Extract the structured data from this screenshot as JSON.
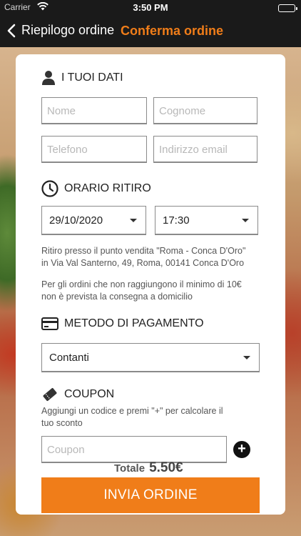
{
  "status_bar": {
    "carrier": "Carrier",
    "time": "3:50 PM"
  },
  "nav": {
    "back_label": "Riepilogo ordine",
    "title": "Conferma ordine",
    "accent_color": "#f07d19"
  },
  "personal": {
    "title": "I TUOI DATI",
    "icon": "user-icon",
    "name_placeholder": "Nome",
    "surname_placeholder": "Cognome",
    "phone_placeholder": "Telefono",
    "email_placeholder": "Indirizzo email"
  },
  "pickup": {
    "title": "ORARIO RITIRO",
    "icon": "clock-icon",
    "date_value": "29/10/2020",
    "time_value": "17:30",
    "note_address_1": "Ritiro presso il punto vendita \"Roma - Conca D'Oro\"",
    "note_address_2": "in Via Val Santerno, 49, Roma, 00141 Conca D'Oro",
    "note_minimum_1": "Per gli ordini che non raggiungono il minimo di 10€",
    "note_minimum_2": "non è prevista la consegna a domicilio"
  },
  "payment": {
    "title": "METODO DI PAGAMENTO",
    "icon": "credit-card-icon",
    "method_value": "Contanti"
  },
  "coupon": {
    "title": "COUPON",
    "icon": "ticket-icon",
    "hint_1": "Aggiungi un codice e premi \"+\" per calcolare il",
    "hint_2": "tuo sconto",
    "placeholder": "Coupon",
    "add_symbol": "+"
  },
  "summary": {
    "total_label": "Totale",
    "total_value": "5.50€"
  },
  "submit_label": "INVIA ORDINE"
}
